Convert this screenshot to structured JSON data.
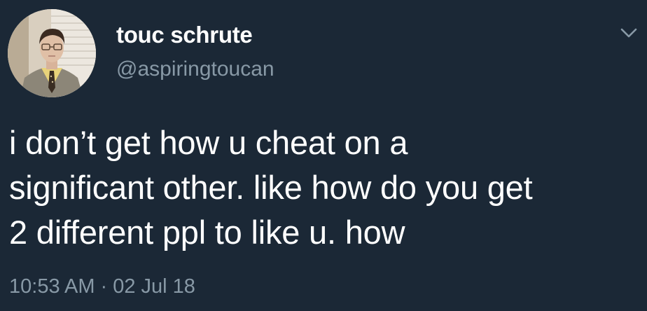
{
  "tweet": {
    "author": {
      "display_name": "touc schrute",
      "handle": "@aspiringtoucan"
    },
    "text_lines": [
      "i don’t get how u cheat on a",
      "significant other. like how do you get",
      "2 different ppl to like u. how"
    ],
    "time": "10:53 AM",
    "separator": "·",
    "date": "02 Jul 18"
  },
  "icons": {
    "menu": "chevron-down-icon",
    "avatar": "avatar"
  },
  "colors": {
    "background": "#1b2836",
    "text_primary": "#ffffff",
    "text_secondary": "#8899a6"
  }
}
